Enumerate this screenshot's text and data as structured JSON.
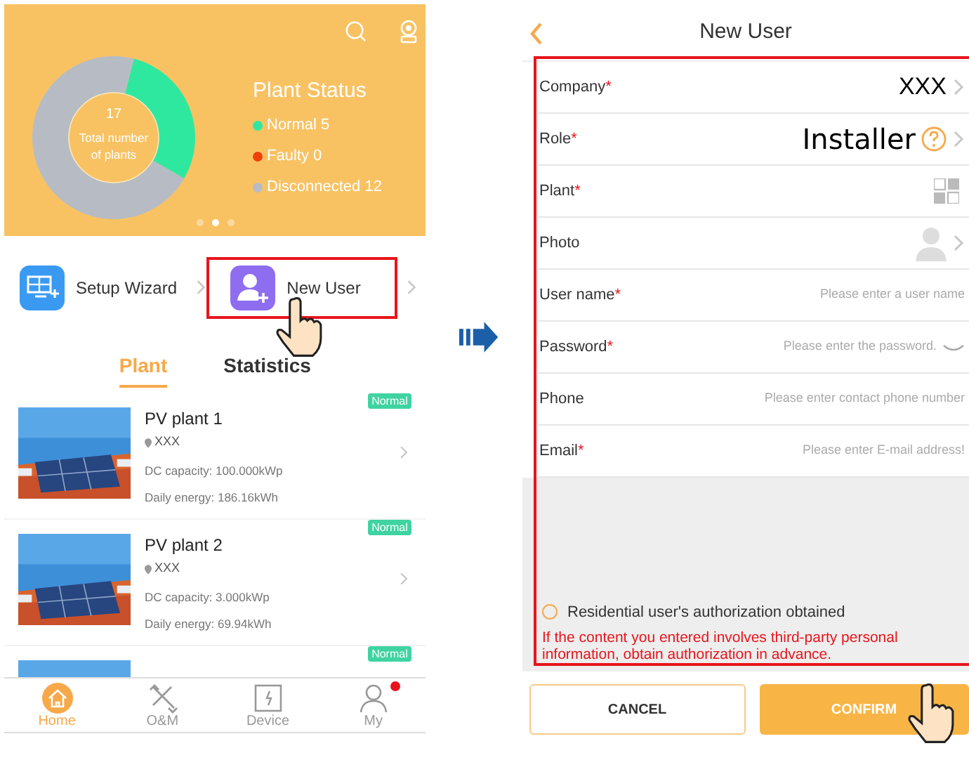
{
  "home": {
    "status": {
      "title": "Plant Status",
      "center_value": "17",
      "center_label": "Total number of plants",
      "legend": [
        {
          "label": "Normal 5",
          "color": "#2ee8a0"
        },
        {
          "label": "Faulty 0",
          "color": "#f0400a"
        },
        {
          "label": "Disconnected 12",
          "color": "#b7bcc4"
        }
      ]
    },
    "pager": [
      {
        "selected": false
      },
      {
        "selected": true
      },
      {
        "selected": false
      }
    ],
    "shortcuts": [
      {
        "label": "Setup Wizard",
        "kind": "wizard",
        "highlighted": false
      },
      {
        "label": "New User",
        "kind": "user",
        "highlighted": true
      }
    ],
    "tabs": [
      {
        "label": "Plant",
        "selected": true
      },
      {
        "label": "Statistics",
        "selected": false
      }
    ],
    "plants": [
      {
        "name": "PV plant 1",
        "location": "XXX",
        "capacity": "DC capacity: 100.000kWp",
        "energy": "Daily energy: 186.16kWh",
        "status": "Normal"
      },
      {
        "name": "PV plant 2",
        "location": "XXX",
        "capacity": "DC capacity: 3.000kWp",
        "energy": "Daily energy: 69.94kWh",
        "status": "Normal"
      },
      {
        "status": "Normal"
      }
    ],
    "nav": [
      {
        "label": "Home",
        "kind": "home",
        "selected": true,
        "badge": false
      },
      {
        "label": "O&M",
        "kind": "tools",
        "selected": false,
        "badge": false
      },
      {
        "label": "Device",
        "kind": "device",
        "selected": false,
        "badge": false
      },
      {
        "label": "My",
        "kind": "person",
        "selected": false,
        "badge": true
      }
    ]
  },
  "new_user": {
    "title": "New User",
    "fields": [
      {
        "label": "Company",
        "mark": "*",
        "kind": "select",
        "value": "XXX"
      },
      {
        "label": "Role",
        "mark": "*",
        "kind": "select",
        "value": "Installer",
        "help": true
      },
      {
        "label": "Plant",
        "mark": "*",
        "kind": "scan"
      },
      {
        "label": "Photo"
      },
      {
        "label": "User name",
        "mark": "*",
        "kind": "input",
        "placeholder": "Please enter a user name"
      },
      {
        "label": "Password",
        "mark": "*",
        "kind": "password",
        "placeholder": "Please enter the password."
      },
      {
        "label": "Phone",
        "kind": "input",
        "placeholder": "Please enter contact phone number"
      },
      {
        "label": "Email",
        "mark": "*",
        "kind": "input",
        "placeholder": "Please enter E-mail address!"
      }
    ],
    "authorization": {
      "label": "Residential user's authorization obtained",
      "checked": false
    },
    "warning": "If the content you entered involves third-party personal information, obtain authorization in advance.",
    "buttons": [
      {
        "label": "CANCEL",
        "kind": "secondary"
      },
      {
        "label": "CONFIRM",
        "kind": "primary",
        "highlighted": true
      }
    ]
  }
}
